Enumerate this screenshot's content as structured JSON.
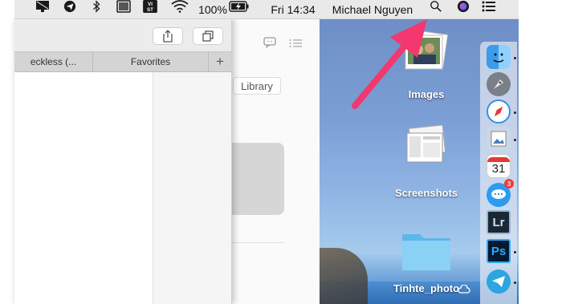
{
  "menubar": {
    "battery": "100%",
    "clock": "Fri 14:34",
    "user": "Michael Nguyen",
    "icons": [
      "display-icon",
      "telegram-icon",
      "bluetooth-icon",
      "window-icon",
      "vietnamese-input-icon",
      "wifi-icon",
      "battery-charging-icon",
      "search-icon",
      "siri-icon",
      "notification-list-icon"
    ],
    "vi_label": "VI\nST"
  },
  "window": {
    "tabs": [
      "eckless (...",
      "Favorites"
    ],
    "add_tab": "+"
  },
  "background_window": {
    "library_label": "Library"
  },
  "desktop": {
    "items": [
      {
        "label": "Images"
      },
      {
        "label": "Screenshots"
      },
      {
        "label": "Tinhte_photo"
      }
    ]
  },
  "dock": {
    "calendar_day": "31",
    "messages_badge": "3",
    "lr_label": "Lr",
    "ps_label": "Ps"
  },
  "colors": {
    "arrow": "#f2386f",
    "menubar": "#e9e9ea"
  }
}
